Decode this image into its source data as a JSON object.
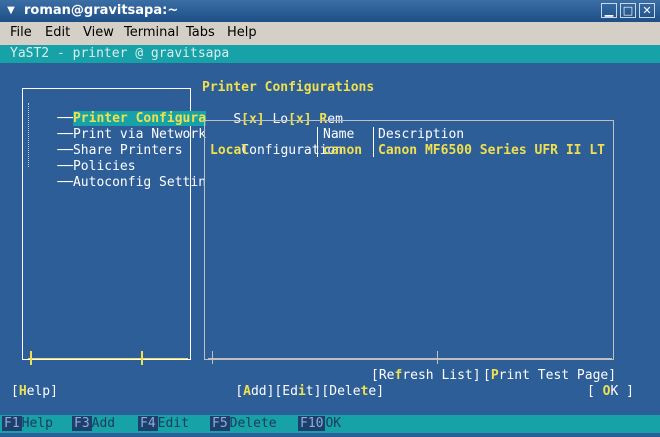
{
  "window": {
    "title": "roman@gravitsapa:~",
    "menu_icon": "down-arrow-icon",
    "buttons": {
      "minimize": "▁",
      "maximize": "□",
      "close": "✕"
    }
  },
  "menubar": [
    "File",
    "Edit",
    "View",
    "Terminal",
    "Tabs",
    "Help"
  ],
  "yast": {
    "title": "YaST2 - printer @ gravitsapa",
    "sidebar": {
      "items": [
        "Printer Configura",
        "Print via Network",
        "Share Printers",
        "Policies",
        "Autoconfig Settin"
      ],
      "selected_index": 0
    },
    "section_title": "Printer Configurations",
    "filters": [
      {
        "label": "S",
        "state": "[x]"
      },
      {
        "label": "Lo",
        "state": "[x]"
      },
      {
        "label": "Rem",
        "state": ""
      }
    ],
    "table": {
      "columns": [
        "Configuration",
        "Name",
        "Description"
      ],
      "rows": [
        [
          "Local",
          "canon",
          "Canon MF6500 Series UFR II LT"
        ]
      ]
    },
    "buttons": {
      "add": "[Add]",
      "edit": "[Edit]",
      "delete": "[Delete]",
      "refresh": "[Refresh List]",
      "print_test": "[Print Test Page]",
      "help": "[Help]",
      "ok": "[ OK ]"
    },
    "fkeys": [
      {
        "key": "F1",
        "label": "Help"
      },
      {
        "key": "F3",
        "label": "Add"
      },
      {
        "key": "F4",
        "label": "Edit"
      },
      {
        "key": "F5",
        "label": "Delete"
      },
      {
        "key": "F10",
        "label": "OK"
      }
    ]
  }
}
